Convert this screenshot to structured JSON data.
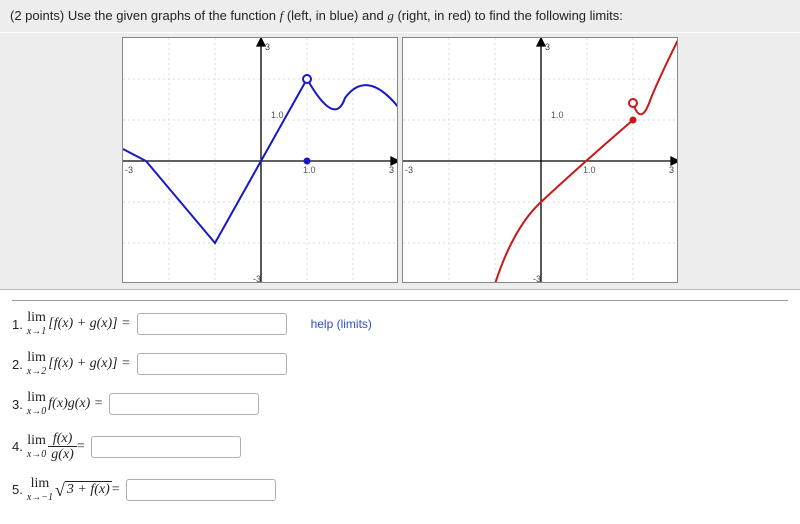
{
  "header": {
    "points": "(2 points)",
    "instruction": "Use the given graphs of the function",
    "f_label": "f",
    "f_desc": "(left, in blue) and",
    "g_label": "g",
    "g_desc": "(right, in red) to find the following limits:"
  },
  "axis_labels": {
    "one": "1.0",
    "neg3_left": "-3",
    "three_right": "3",
    "one_right_x": "1.0"
  },
  "chart_data": [
    {
      "type": "line",
      "name": "f",
      "color": "#1818c8",
      "xlim": [
        -3,
        3
      ],
      "ylim": [
        -3,
        3
      ],
      "axis_tick_x_label": "1.0",
      "axis_tick_y_label": "1.0",
      "points": [
        {
          "x": -3.0,
          "y": 0.3
        },
        {
          "x": -2.5,
          "y": 0.0
        },
        {
          "x": -1.0,
          "y": -2.0
        },
        {
          "x": 0.0,
          "y": 0.0
        },
        {
          "x": 1.0,
          "y": 2.0,
          "open": true
        },
        {
          "x": 1.6,
          "y": 1.0
        },
        {
          "x": 2.2,
          "y": 1.6
        },
        {
          "x": 3.0,
          "y": 1.3
        }
      ],
      "markers": [
        {
          "x": 1.0,
          "y": 2.0,
          "kind": "open"
        },
        {
          "x": 1.0,
          "y": 0.0,
          "kind": "closed"
        }
      ]
    },
    {
      "type": "line",
      "name": "g",
      "color": "#c81818",
      "xlim": [
        -3,
        3
      ],
      "ylim": [
        -3,
        3
      ],
      "axis_tick_x_label": "1.0",
      "axis_tick_y_label": "1.0",
      "segments": [
        [
          {
            "x": -1.0,
            "y": -3.0
          },
          {
            "x": -0.5,
            "y": -1.7
          },
          {
            "x": 0.0,
            "y": -1.0
          },
          {
            "x": 1.0,
            "y": 0.2
          },
          {
            "x": 2.0,
            "y": 1.0
          }
        ],
        [
          {
            "x": 2.0,
            "y": 1.4
          },
          {
            "x": 2.2,
            "y": 1.0
          },
          {
            "x": 2.5,
            "y": 1.6
          },
          {
            "x": 3.0,
            "y": 3.0
          }
        ]
      ],
      "markers": [
        {
          "x": 2.0,
          "y": 1.0,
          "kind": "closed"
        },
        {
          "x": 2.0,
          "y": 1.4,
          "kind": "open"
        }
      ]
    }
  ],
  "questions": {
    "q1": {
      "num": "1.",
      "expr_before_lim": "",
      "lim_sub": "x→1",
      "expr": "[f(x) + g(x)] ="
    },
    "q2": {
      "num": "2.",
      "lim_sub": "x→2",
      "expr": "[f(x) + g(x)] ="
    },
    "q3": {
      "num": "3.",
      "lim_sub": "x→0",
      "expr": "f(x)g(x) ="
    },
    "q4": {
      "num": "4.",
      "lim_sub": "x→0",
      "frac_num": "f(x)",
      "frac_den": "g(x)",
      "after": " ="
    },
    "q5": {
      "num": "5.",
      "lim_sub": "x→−1",
      "radicand": "3 + f(x)",
      "after": " ="
    }
  },
  "help": {
    "label": "help (limits)"
  },
  "lim_word": "lim"
}
